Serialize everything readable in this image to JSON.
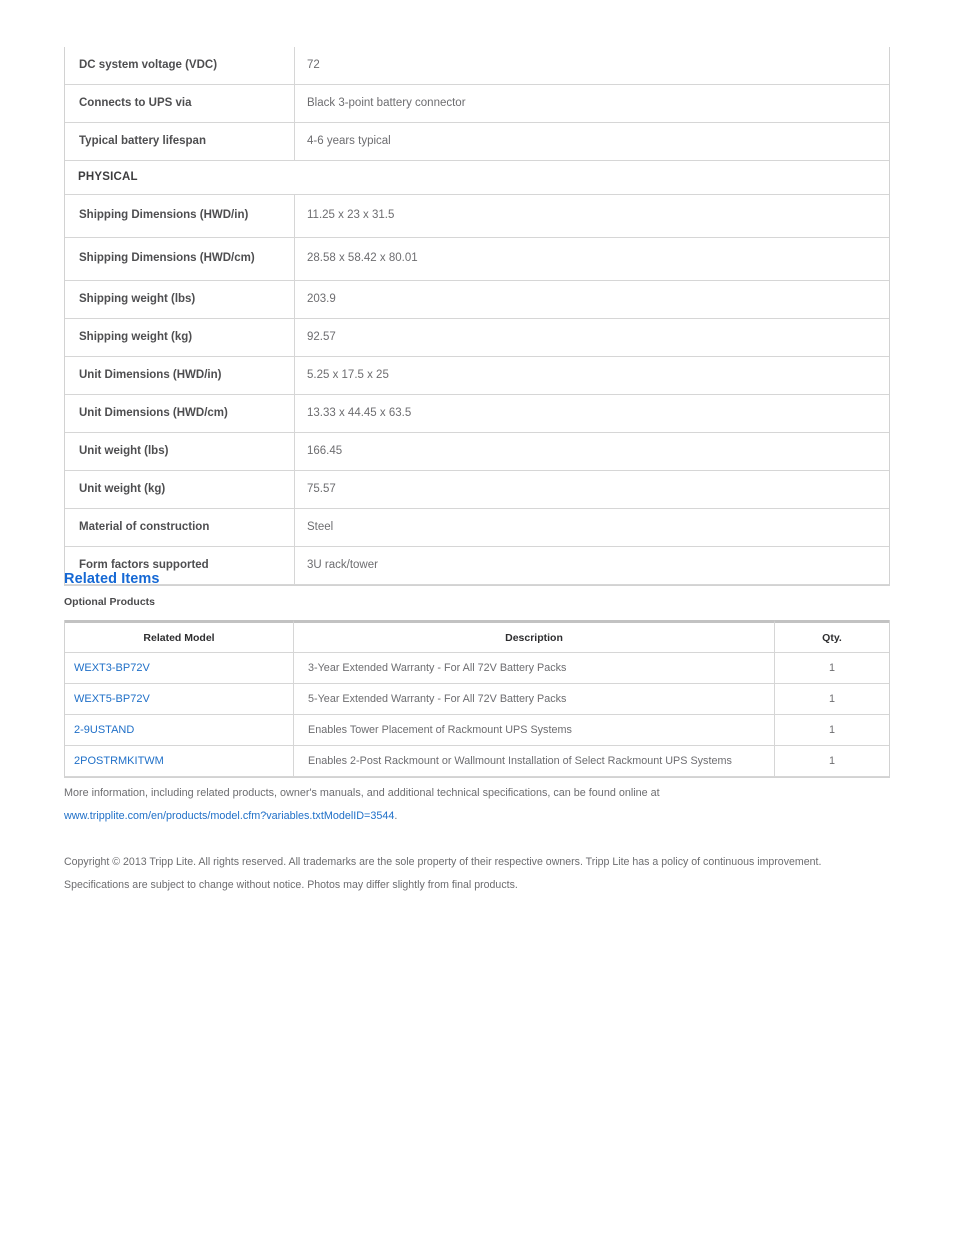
{
  "spec_table": {
    "rows": [
      {
        "label": "DC system voltage (VDC)",
        "value": "72",
        "type": "row"
      },
      {
        "label": "Connects to UPS via",
        "value": "Black 3-point battery connector",
        "type": "row"
      },
      {
        "label": "Typical battery lifespan",
        "value": "4-6 years typical",
        "type": "row"
      },
      {
        "label": "PHYSICAL",
        "value": "",
        "type": "section"
      },
      {
        "label": "Shipping Dimensions (HWD/in)",
        "value": "11.25 x 23 x 31.5",
        "type": "tall"
      },
      {
        "label": "Shipping Dimensions (HWD/cm)",
        "value": "28.58 x 58.42 x 80.01",
        "type": "tall"
      },
      {
        "label": "Shipping weight (lbs)",
        "value": "203.9",
        "type": "row"
      },
      {
        "label": "Shipping weight (kg)",
        "value": "92.57",
        "type": "row"
      },
      {
        "label": "Unit Dimensions (HWD/in)",
        "value": "5.25 x 17.5 x 25",
        "type": "row"
      },
      {
        "label": "Unit Dimensions (HWD/cm)",
        "value": "13.33 x 44.45 x 63.5",
        "type": "row"
      },
      {
        "label": "Unit weight (lbs)",
        "value": "166.45",
        "type": "row"
      },
      {
        "label": "Unit weight (kg)",
        "value": "75.57",
        "type": "row"
      },
      {
        "label": "Material of construction",
        "value": "Steel",
        "type": "row"
      },
      {
        "label": "Form factors supported",
        "value": "3U rack/tower",
        "type": "row"
      }
    ]
  },
  "related": {
    "heading": "Related Items",
    "subheading": "Optional Products",
    "columns": [
      "Related Model",
      "Description",
      "Qty."
    ],
    "rows": [
      {
        "model": "WEXT3-BP72V",
        "description": "3-Year Extended Warranty - For All 72V Battery Packs",
        "qty": "1"
      },
      {
        "model": "WEXT5-BP72V",
        "description": "5-Year Extended Warranty - For All 72V Battery Packs",
        "qty": "1"
      },
      {
        "model": "2-9USTAND",
        "description": "Enables Tower Placement of Rackmount UPS Systems",
        "qty": "1"
      },
      {
        "model": "2POSTRMKITWM",
        "description": "Enables 2-Post Rackmount or Wallmount Installation of Select Rackmount UPS Systems",
        "qty": "1"
      }
    ]
  },
  "footer": {
    "more_info_text": "More information, including related products, owner's manuals, and additional technical specifications, can be found online at",
    "more_info_url": "www.tripplite.com/en/products/model.cfm?variables.txtModelID=3544",
    "more_info_period": ".",
    "copyright": "Copyright © 2013 Tripp Lite. All rights reserved. All trademarks are the sole property of their respective owners. Tripp Lite has a policy of continuous improvement. Specifications are subject to change without notice. Photos may differ slightly from final products."
  },
  "colors": {
    "link": "#2070c8",
    "heading": "#1568d4",
    "text": "#6d6d70",
    "label": "#4e4e50",
    "border": "#d6d6d6"
  }
}
